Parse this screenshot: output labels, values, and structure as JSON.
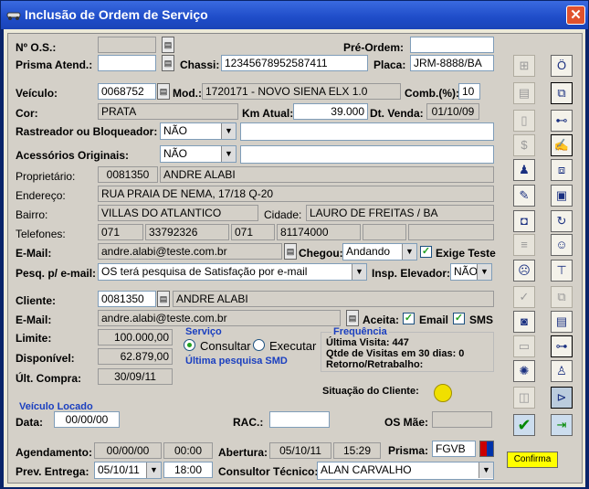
{
  "window": {
    "title": "Inclusão de Ordem de Serviço",
    "close": "✕"
  },
  "labels": {
    "os": "Nº O.S.:",
    "prisma": "Prisma Atend.:",
    "preordem": "Pré-Ordem:",
    "chassi": "Chassi:",
    "placa": "Placa:",
    "veiculo": "Veículo:",
    "mod": "Mod.:",
    "comb": "Comb.(%):",
    "cor": "Cor:",
    "km": "Km Atual:",
    "dtvenda": "Dt. Venda:",
    "rastreador": "Rastreador ou Bloqueador:",
    "acessorios": "Acessórios Originais:",
    "proprietario": "Proprietário:",
    "endereco": "Endereço:",
    "bairro": "Bairro:",
    "cidade": "Cidade:",
    "telefones": "Telefones:",
    "email": "E-Mail:",
    "chegou": "Chegou:",
    "exigeteste": "Exige Teste",
    "pesq": "Pesq. p/ e-mail:",
    "inspelev": "Insp. Elevador:",
    "cliente": "Cliente:",
    "email2": "E-Mail:",
    "aceita": "Aceita:",
    "emailcb": "Email",
    "sms": "SMS",
    "limite": "Limite:",
    "disponivel": "Disponível:",
    "ultcompra": "Últ. Compra:",
    "situacao": "Situação do Cliente:",
    "data": "Data:",
    "rac": "RAC.:",
    "osmae": "OS Mãe:",
    "agendamento": "Agendamento:",
    "abertura": "Abertura:",
    "prisma2": "Prisma:",
    "preventrega": "Prev. Entrega:",
    "consultor": "Consultor Técnico:"
  },
  "fields": {
    "os": "",
    "prisma": "",
    "preordem": "",
    "chassi": "12345678952587411",
    "placa": "JRM-8888/BA",
    "veiculo_cod": "0068752",
    "modelo": "1720171 - NOVO SIENA ELX 1.0",
    "comb": "10",
    "cor": "PRATA",
    "km": "39.000",
    "dtvenda": "01/10/09",
    "rastreador_sel": "NÃO",
    "rastreador_txt": "",
    "acessorios_sel": "NÃO",
    "acessorios_txt": "",
    "prop_cod": "0081350",
    "prop_nome": "ANDRE ALABI",
    "endereco": "RUA PRAIA DE NEMA, 17/18 Q-20",
    "bairro": "VILLAS DO ATLANTICO",
    "cidade": "LAURO DE FREITAS / BA",
    "tel1_ddd": "071",
    "tel1": "33792326",
    "tel2_ddd": "071",
    "tel2": "81174000",
    "tel3_ddd": "",
    "tel3": "",
    "email": "andre.alabi@teste.com.br",
    "chegou": "Andando",
    "pesq": "OS terá pesquisa de Satisfação por e-mail",
    "inspelev": "NÃO",
    "cli_cod": "0081350",
    "cli_nome": "ANDRE ALABI",
    "cli_email": "andre.alabi@teste.com.br",
    "limite": "100.000,00",
    "disponivel": "62.879,00",
    "ultcompra": "30/09/11",
    "data": "00/00/00",
    "rac": "",
    "osmae": "",
    "agend_data": "00/00/00",
    "agend_hora": "00:00",
    "abert_data": "05/10/11",
    "abert_hora": "15:29",
    "prisma_val": "FGVB",
    "prev_data": "05/10/11",
    "prev_hora": "18:00",
    "consultor": "ALAN CARVALHO"
  },
  "servico": {
    "title": "Serviço",
    "opt1": "Consultar",
    "opt2": "Executar",
    "ultima": "Última pesquisa SMD"
  },
  "frequencia": {
    "title": "Frequência",
    "visita": "Última Visita: 447",
    "qtde": "Qtde de Visitas em 30 dias: 0",
    "retorno": "Retorno/Retrabalho:"
  },
  "veiculo_locado": {
    "title": "Veículo Locado"
  },
  "confirma": "Confirma",
  "status_color": "#f0e000"
}
